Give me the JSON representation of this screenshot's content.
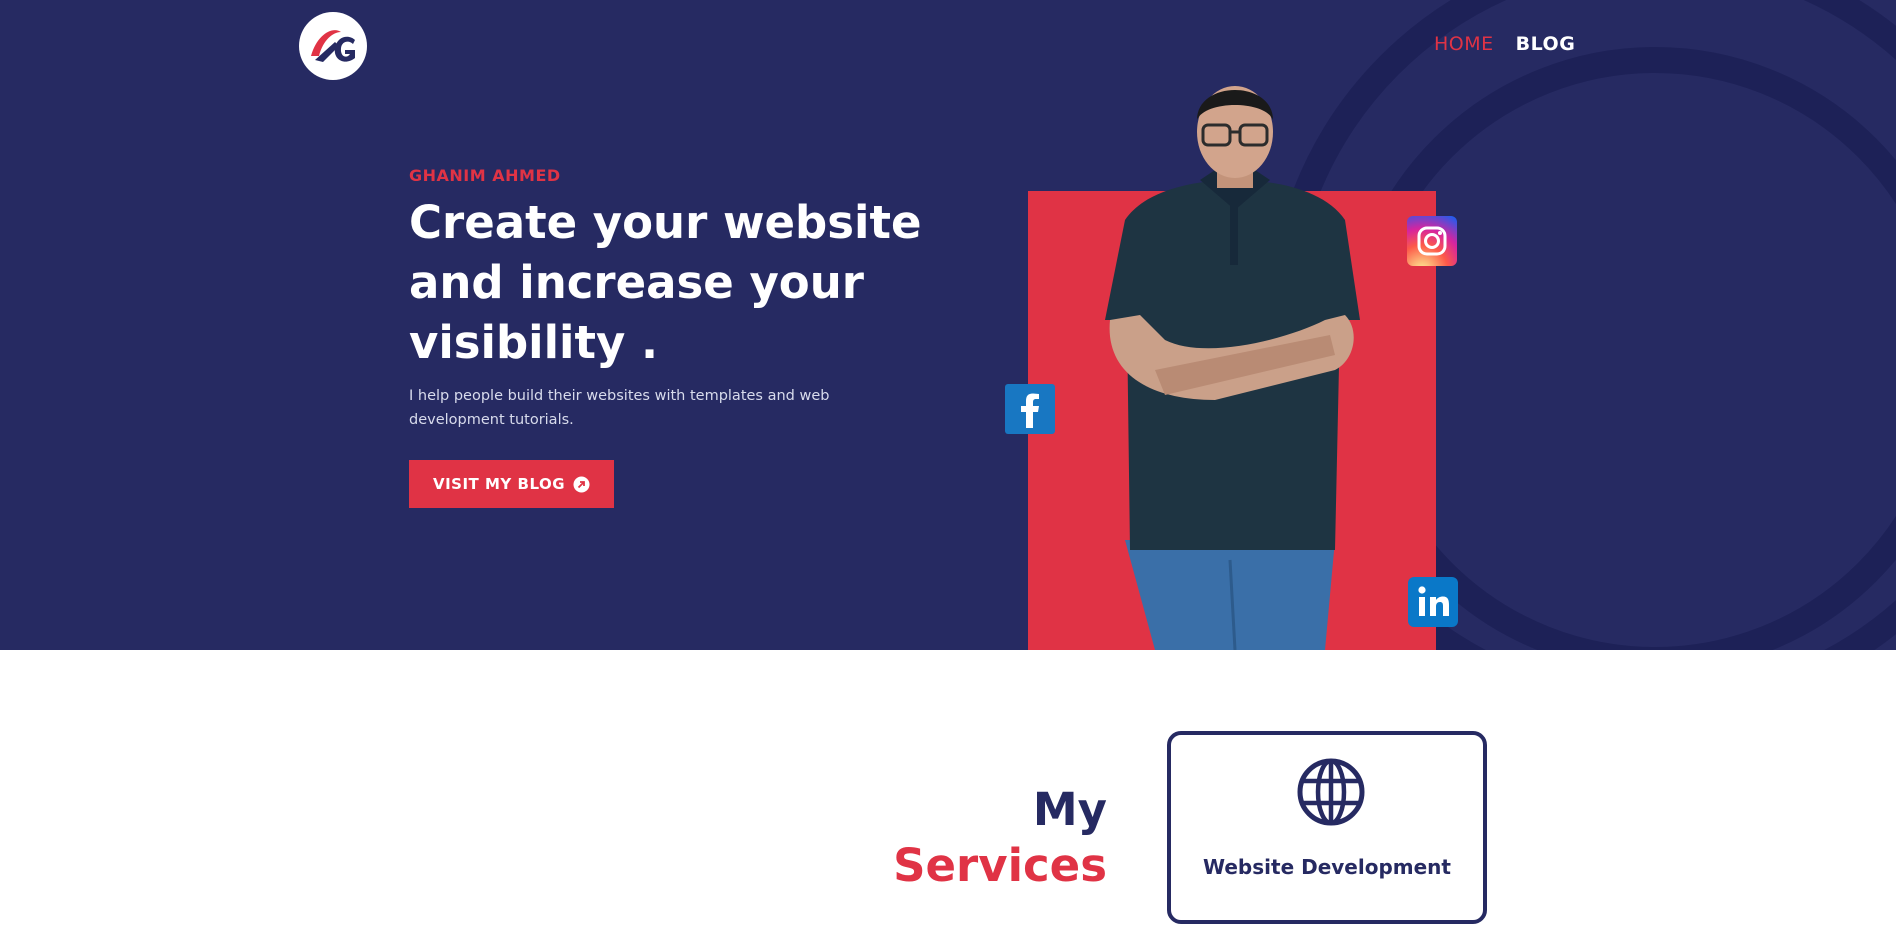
{
  "nav": {
    "home_label": "HOME",
    "blog_label": "BLOG"
  },
  "hero": {
    "eyebrow": "GHANIM AHMED",
    "headline": "Create your website and increase your visibility .",
    "lede": "I help people build their websites with templates and web development tutorials.",
    "cta_label": "VISIT MY BLOG",
    "cta_icon": "arrow-circle-icon"
  },
  "social": [
    "instagram-icon",
    "facebook-icon",
    "linkedin-icon"
  ],
  "services": {
    "title_line1": "My",
    "title_line2": "Services",
    "cards": [
      {
        "label": "Website Development",
        "icon": "globe-icon"
      }
    ]
  },
  "colors": {
    "navy": "#262a62",
    "accent": "#e03345",
    "white": "#ffffff"
  }
}
